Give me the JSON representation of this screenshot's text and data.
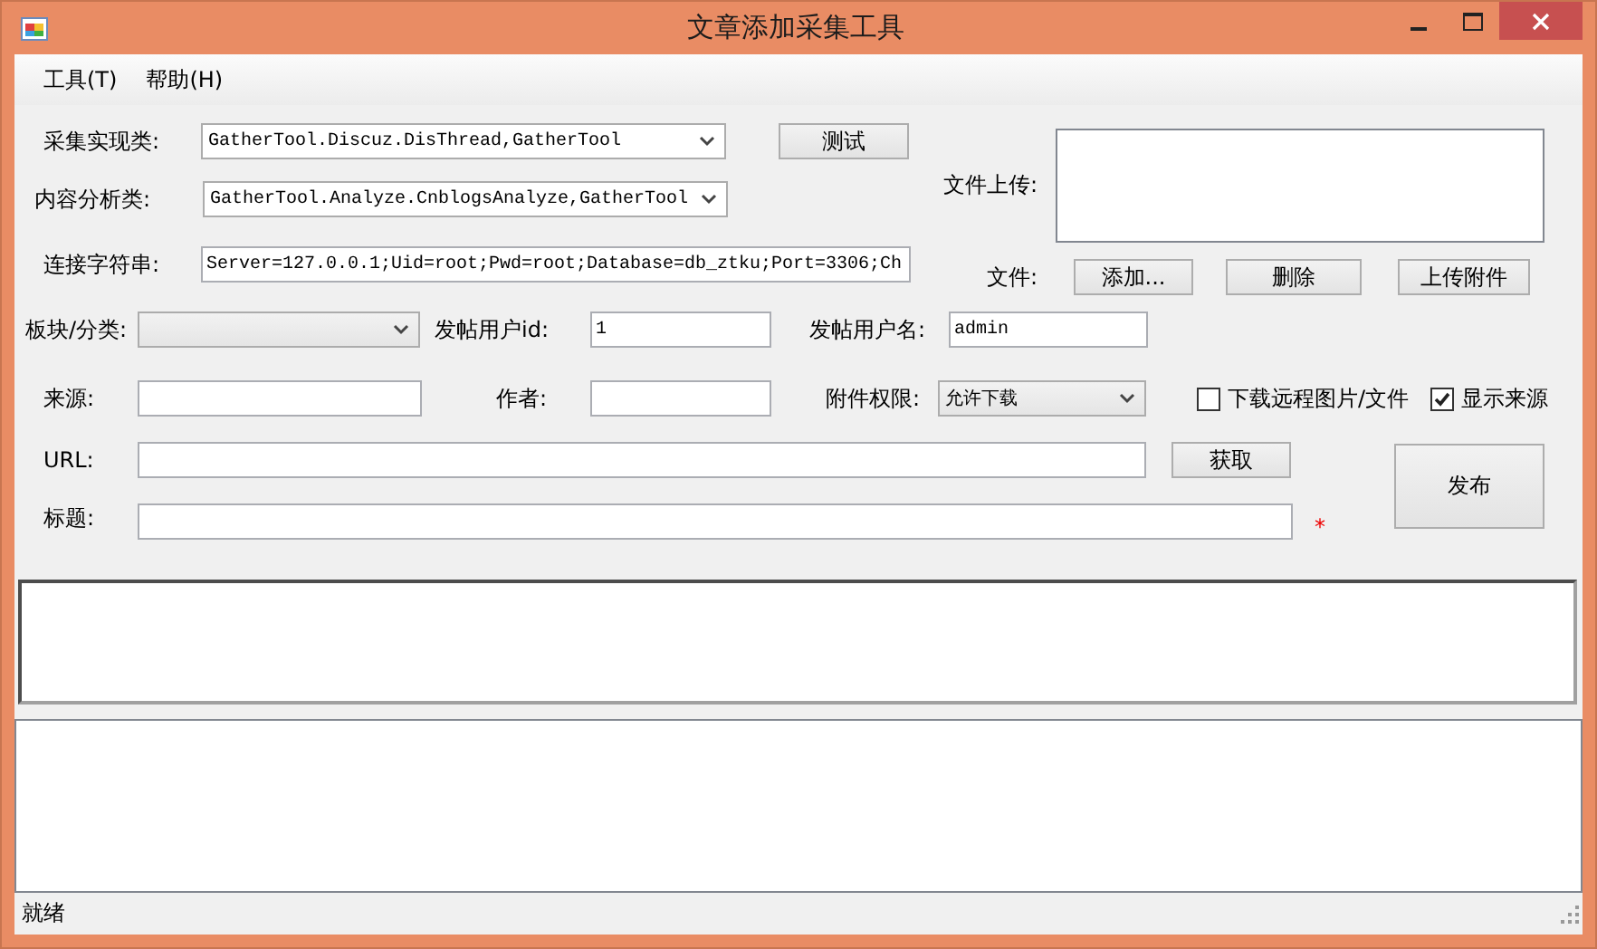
{
  "window": {
    "title": "文章添加采集工具"
  },
  "menu": [
    {
      "label": "工具(T)"
    },
    {
      "label": "帮助(H)"
    }
  ],
  "gather_class": {
    "label": "采集实现类:",
    "value": "GatherTool.Discuz.DisThread,GatherTool"
  },
  "test_button": "测试",
  "analyze_class": {
    "label": "内容分析类:",
    "value": "GatherTool.Analyze.CnblogsAnalyze,GatherTool"
  },
  "connection_string": {
    "label": "连接字符串:",
    "value": "Server=127.0.0.1;Uid=root;Pwd=root;Database=db_ztku;Port=3306;Ch"
  },
  "file_upload": {
    "label": "文件上传:",
    "files_label": "文件:",
    "buttons": [
      "添加...",
      "删除",
      "上传附件"
    ]
  },
  "category": {
    "label": "板块/分类:"
  },
  "user_id": {
    "label": "发帖用户id:",
    "value": "1"
  },
  "user_name": {
    "label": "发帖用户名:",
    "value": "admin"
  },
  "source": {
    "label": "来源:"
  },
  "author": {
    "label": "作者:"
  },
  "attachment_permission": {
    "label": "附件权限:",
    "value": "允许下载"
  },
  "options": [
    {
      "label": "下载远程图片/文件",
      "checked": false
    },
    {
      "label": "显示来源",
      "checked": true
    }
  ],
  "url": {
    "label": "URL:"
  },
  "fetch_button": "获取",
  "publish_button": "发布",
  "title_field": {
    "label": "标题:",
    "required_mark": "*"
  },
  "status_bar": "就绪"
}
